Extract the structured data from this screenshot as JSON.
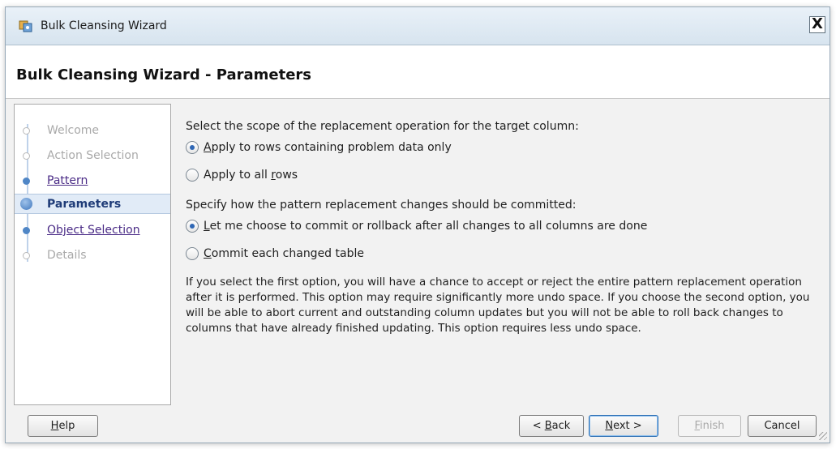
{
  "window": {
    "title": "Bulk Cleansing Wizard",
    "close_glyph": "X"
  },
  "header": {
    "title": "Bulk Cleansing Wizard - Parameters"
  },
  "steps": [
    {
      "label": "Welcome",
      "state": "disabled"
    },
    {
      "label": "Action Selection",
      "state": "disabled"
    },
    {
      "label": "Pattern",
      "state": "link"
    },
    {
      "label": "Parameters",
      "state": "current"
    },
    {
      "label": "Object Selection",
      "state": "link"
    },
    {
      "label": "Details",
      "state": "disabled"
    }
  ],
  "main": {
    "scope_prompt": "Select the scope of the replacement operation for the target column:",
    "scope_options": [
      {
        "pre": "",
        "u": "A",
        "post": "pply to rows containing problem data only",
        "checked": true
      },
      {
        "pre": "Apply to all ",
        "u": "r",
        "post": "ows",
        "checked": false
      }
    ],
    "commit_prompt": "Specify how the pattern replacement changes should be committed:",
    "commit_options": [
      {
        "pre": "",
        "u": "L",
        "post": "et me choose to commit or rollback after all changes to all columns are done",
        "checked": true
      },
      {
        "pre": "",
        "u": "C",
        "post": "ommit each changed table",
        "checked": false
      }
    ],
    "description": "If you select the first option, you will have a chance to accept or reject the entire pattern replacement operation after it is performed. This option may require significantly more undo space. If you choose the second option, you will be able to abort current and outstanding column updates but you will not be able to roll back changes to columns that have already finished updating. This option requires less undo space."
  },
  "buttons": {
    "help": {
      "u": "H",
      "post": "elp"
    },
    "back": {
      "pre": "< ",
      "u": "B",
      "post": "ack"
    },
    "next": {
      "u": "N",
      "post": "ext >"
    },
    "finish": {
      "u": "F",
      "post": "inish"
    },
    "cancel": "Cancel"
  },
  "icons": {
    "title_icon": "wizard-app-icon",
    "close": "close-icon",
    "resize": "resize-grip-icon"
  },
  "colors": {
    "titlebar": "#dce8f2",
    "current_step": "#1f3c78",
    "link_step": "#4a2b86",
    "radio_dot": "#2f67b5"
  }
}
